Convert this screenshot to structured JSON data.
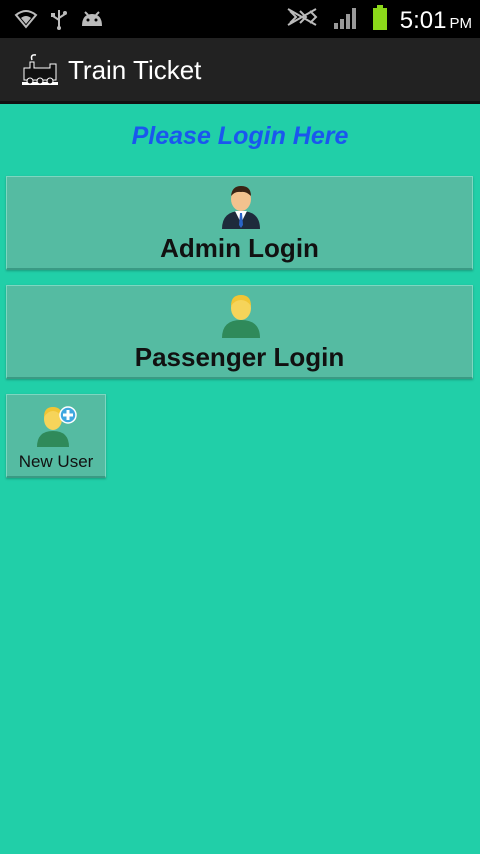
{
  "status_bar": {
    "time": "5:01",
    "ampm": "PM",
    "icons": [
      "wifi-icon",
      "usb-icon",
      "android-icon",
      "no-signal-icon",
      "signal-bars-icon",
      "battery-icon"
    ],
    "battery_color": "#8cd81a"
  },
  "action_bar": {
    "title": "Train Ticket",
    "logo": "train-logo-icon"
  },
  "main": {
    "heading": "Please Login Here",
    "heading_color": "#1a57ee",
    "admin_button": {
      "label": "Admin Login",
      "icon": "admin-user-icon"
    },
    "passenger_button": {
      "label": "Passenger Login",
      "icon": "passenger-user-icon"
    },
    "new_user_button": {
      "label": "New User",
      "icon": "add-user-icon"
    }
  },
  "colors": {
    "background": "#21cfa8",
    "button": "#55bba2",
    "action_bar": "#222222"
  }
}
